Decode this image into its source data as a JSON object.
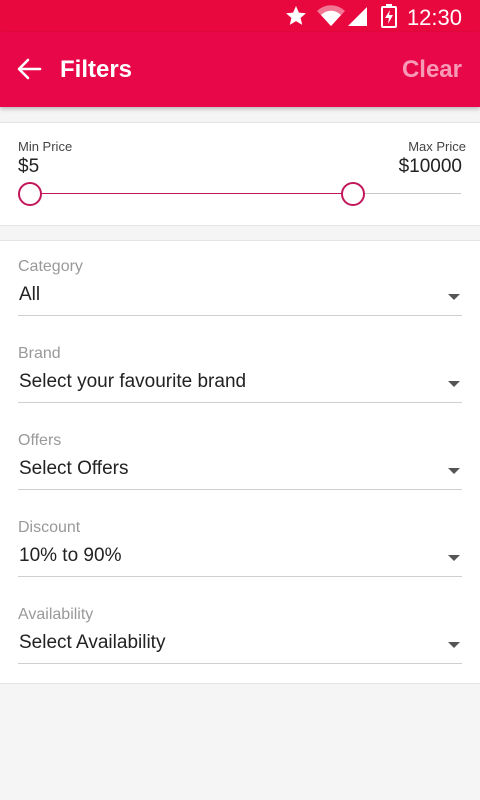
{
  "status_bar": {
    "time": "12:30",
    "icons": [
      "star-icon",
      "wifi-icon",
      "signal-icon",
      "battery-charging-icon"
    ]
  },
  "app_bar": {
    "title": "Filters",
    "clear_label": "Clear",
    "back_icon": "arrow-back-icon"
  },
  "price": {
    "min_label": "Min Price",
    "max_label": "Max Price",
    "min_value": "$5",
    "max_value": "$10000"
  },
  "filters": [
    {
      "label": "Category",
      "value": "All"
    },
    {
      "label": "Brand",
      "value": "Select your favourite brand"
    },
    {
      "label": "Offers",
      "value": "Select Offers"
    },
    {
      "label": "Discount",
      "value": "10% to 90%"
    },
    {
      "label": "Availability",
      "value": "Select Availability"
    }
  ],
  "colors": {
    "status_bar": "#e8083e",
    "app_bar": "#e8084a",
    "clear_text": "#f79ab6",
    "slider_accent": "#c2185b"
  }
}
